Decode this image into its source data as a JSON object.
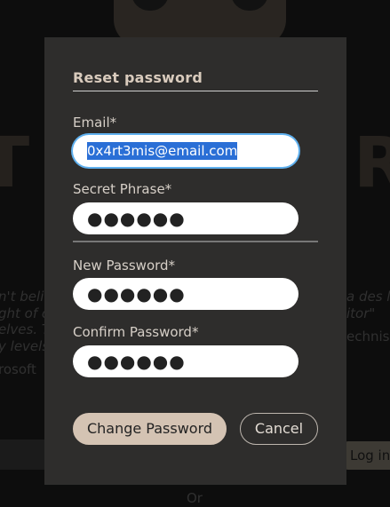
{
  "background": {
    "big_left": "T",
    "big_right": "R",
    "quote_lines_left": [
      "n't beli",
      "ght of c",
      "elves. T",
      "y levels"
    ],
    "quote_lines_right": [
      "a des l",
      "itor\"",
      "echnis"
    ],
    "company_fragment": "rosoft",
    "login_button": "Log in",
    "or_text": "Or"
  },
  "modal": {
    "title": "Reset password",
    "email": {
      "label": "Email*",
      "value": "0x4rt3mis@email.com"
    },
    "secret_phrase": {
      "label": "Secret Phrase*",
      "value": "●●●●●●"
    },
    "new_password": {
      "label": "New Password*",
      "value": "●●●●●●"
    },
    "confirm_password": {
      "label": "Confirm Password*",
      "value": "●●●●●●"
    },
    "change_button": "Change Password",
    "cancel_button": "Cancel"
  },
  "colors": {
    "accent": "#d4c3b3",
    "modal_bg": "#2e2d2c",
    "focus_ring": "#5fb0ee",
    "selection": "#2a6fd6"
  }
}
